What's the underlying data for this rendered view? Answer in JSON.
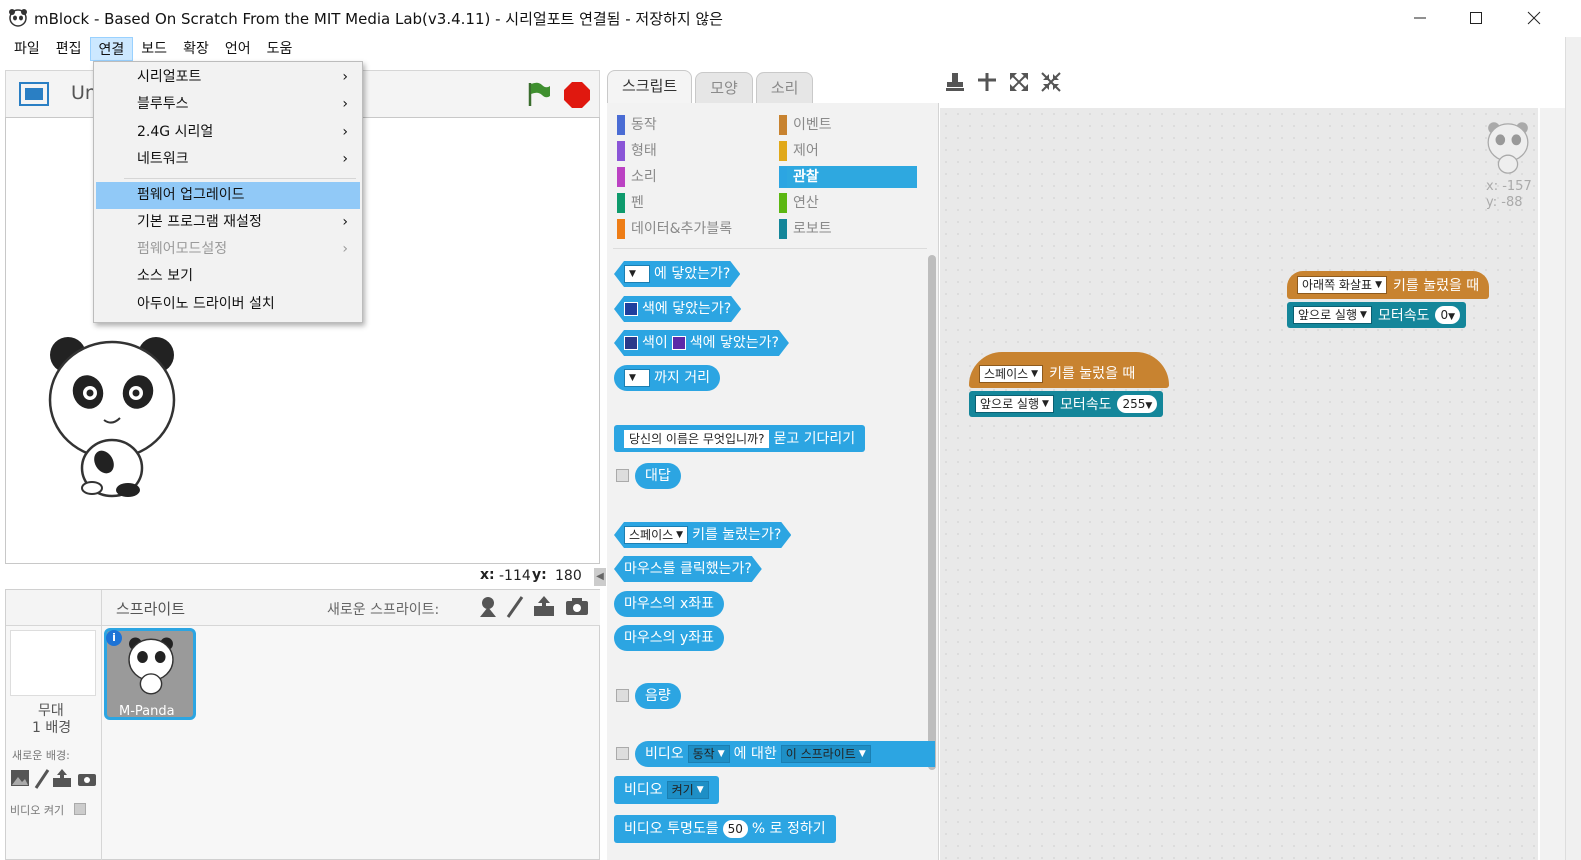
{
  "window": {
    "title": "mBlock - Based On Scratch From the MIT Media Lab(v3.4.11) - 시리얼포트 연결됨 - 저장하지 않은",
    "minimize_icon": "minimize-icon",
    "maximize_icon": "maximize-icon",
    "close_icon": "close-icon"
  },
  "menubar": [
    "파일",
    "편집",
    "연결",
    "보드",
    "확장",
    "언어",
    "도움"
  ],
  "connect_menu": {
    "items": [
      {
        "label": "시리얼포트",
        "submenu": true,
        "disabled": false
      },
      {
        "label": "블루투스",
        "submenu": true,
        "disabled": false
      },
      {
        "label": "2.4G 시리얼",
        "submenu": true,
        "disabled": false
      },
      {
        "label": "네트워크",
        "submenu": true,
        "disabled": false
      },
      {
        "label": "펌웨어 업그레이드",
        "submenu": false,
        "disabled": false,
        "highlighted": true
      },
      {
        "label": "기본 프로그램 재설정",
        "submenu": true,
        "disabled": false
      },
      {
        "label": "펌웨어모드설정",
        "submenu": true,
        "disabled": true
      },
      {
        "label": "소스 보기",
        "submenu": false,
        "disabled": false
      },
      {
        "label": "아두이노 드라이버 설치",
        "submenu": false,
        "disabled": false
      }
    ]
  },
  "stage": {
    "project_name_partial": "Un",
    "mouse_x_label": "x:",
    "mouse_x": "-114",
    "mouse_y_label": "y:",
    "mouse_y": "180"
  },
  "sprites": {
    "header": "스프라이트",
    "new_sprite_label": "새로운 스프라이트:",
    "stage_label": "무대",
    "backdrop_count": "1 배경",
    "new_backdrop_label": "새로운 배경:",
    "video_off_label": "비디오 켜기",
    "sprite_name": "M-Panda"
  },
  "tabs": [
    "스크립트",
    "모양",
    "소리"
  ],
  "categories": [
    {
      "label": "동작",
      "color": "#4a6cd4"
    },
    {
      "label": "형태",
      "color": "#8a55d7"
    },
    {
      "label": "소리",
      "color": "#bb42c3"
    },
    {
      "label": "펜",
      "color": "#0e9a6c"
    },
    {
      "label": "데이터&추가블록",
      "color": "#ee7d16"
    },
    {
      "label": "이벤트",
      "color": "#c88330"
    },
    {
      "label": "제어",
      "color": "#e1a91a"
    },
    {
      "label": "관찰",
      "color": "#2ca5e2",
      "selected": true
    },
    {
      "label": "연산",
      "color": "#5cb712"
    },
    {
      "label": "로보트",
      "color": "#14869a"
    }
  ],
  "palette_blocks": {
    "touching": "에 닿았는가?",
    "touching_color": "색에 닿았는가?",
    "color_a": "색이",
    "color_b": "색에 닿았는가?",
    "distance": "까지 거리",
    "ask_default": "당신의 이름은 무엇입니까?",
    "ask_wait": "묻고 기다리기",
    "answer": "대답",
    "key_space": "스페이스",
    "key_pressed": "키를 눌렀는가?",
    "mouse_down": "마우스를 클릭했는가?",
    "mouse_x": "마우스의 x좌표",
    "mouse_y": "마우스의 y좌표",
    "loudness": "음량",
    "video": "비디오",
    "video_motion": "동작",
    "video_on": "에 대한",
    "video_target": "이 스프라이트",
    "video_state_label": "비디오",
    "video_state": "켜기",
    "transparency_a": "비디오 투명도를",
    "transparency_val": "50",
    "transparency_b": "% 로 정하기"
  },
  "scripts": {
    "sprite_x": "x: -157",
    "sprite_y": "y: -88",
    "script1": {
      "key": "아래쪽 화살표",
      "when_pressed": "키를 눌렀을 때",
      "action": "앞으로 실행",
      "speed_label": "모터속도",
      "speed": "0"
    },
    "script2": {
      "key": "스페이스",
      "when_pressed": "키를 눌렀을 때",
      "action": "앞으로 실행",
      "speed_label": "모터속도",
      "speed": "255"
    }
  }
}
